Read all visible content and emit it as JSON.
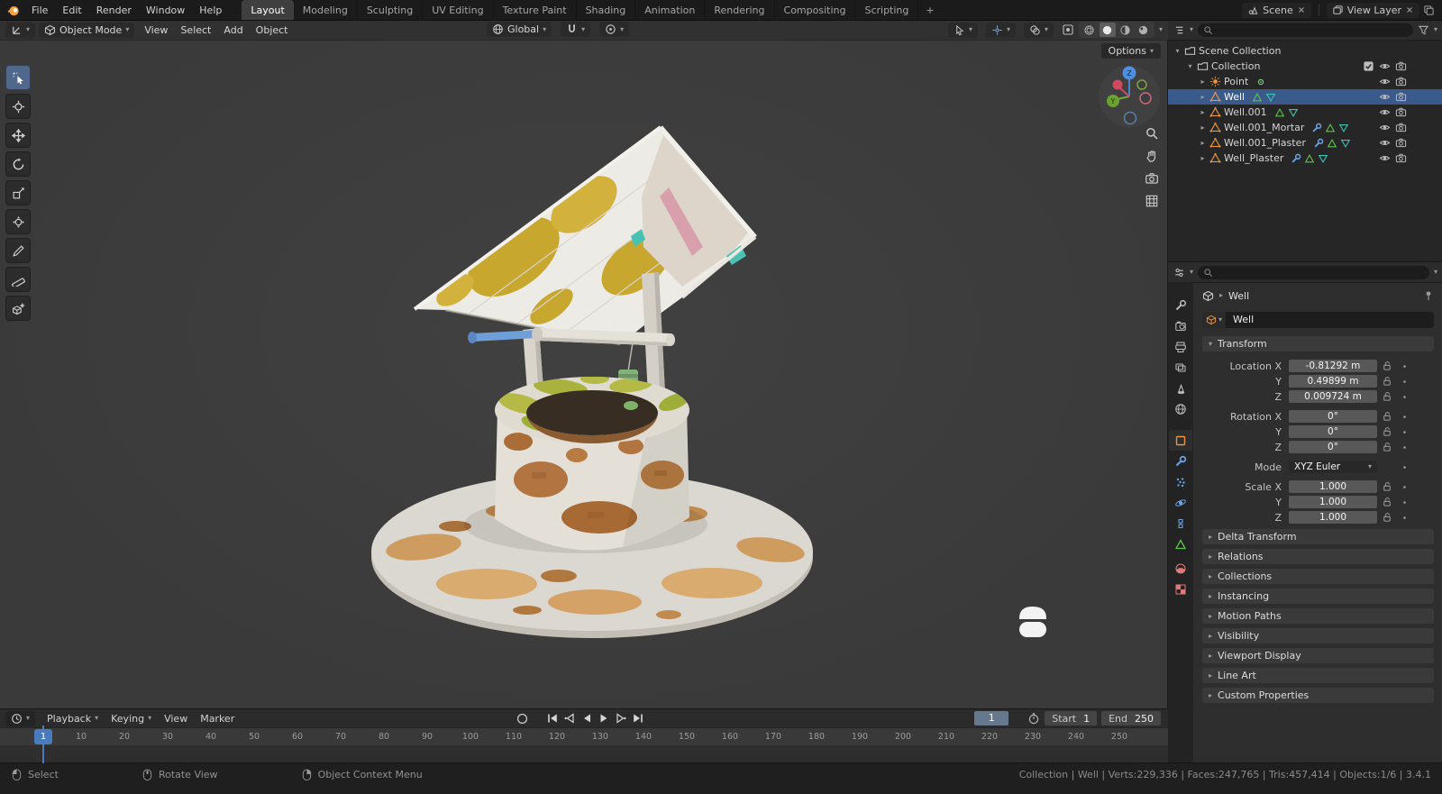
{
  "topbar": {
    "menus": [
      "File",
      "Edit",
      "Render",
      "Window",
      "Help"
    ],
    "workspaces": [
      "Layout",
      "Modeling",
      "Sculpting",
      "UV Editing",
      "Texture Paint",
      "Shading",
      "Animation",
      "Rendering",
      "Compositing",
      "Scripting"
    ],
    "active_workspace": "Layout",
    "add_workspace": "+",
    "scene_selector": "Scene",
    "view_layer_selector": "View Layer"
  },
  "viewport": {
    "header": {
      "mode": "Object Mode",
      "menus": [
        "View",
        "Select",
        "Add",
        "Object"
      ],
      "orientation": "Global",
      "options": "Options"
    },
    "toolbar": [
      "select-box",
      "cursor-3d",
      "move",
      "rotate",
      "scale",
      "transform",
      "annotate",
      "measure",
      "add-cube"
    ],
    "active_tool": "select-box",
    "gizmo": {
      "z": "Z",
      "y": "Y"
    }
  },
  "outliner": {
    "rows": [
      {
        "label": "Scene Collection",
        "depth": 0,
        "icon": "collection",
        "expand": "down",
        "badges": [],
        "right": []
      },
      {
        "label": "Collection",
        "depth": 1,
        "icon": "collection",
        "expand": "down",
        "badges": [],
        "right": [
          "checkbox",
          "eye",
          "camera"
        ]
      },
      {
        "label": "Point",
        "depth": 2,
        "icon": "light",
        "expand": "right",
        "badges": [
          "light-data"
        ],
        "right": [
          "eye",
          "camera"
        ]
      },
      {
        "label": "Well",
        "depth": 2,
        "icon": "mesh",
        "expand": "right",
        "selected": true,
        "badges": [
          "tri-green",
          "tri-teal"
        ],
        "right": [
          "eye",
          "camera"
        ]
      },
      {
        "label": "Well.001",
        "depth": 2,
        "icon": "mesh",
        "expand": "right",
        "badges": [
          "tri-green",
          "tri-teal"
        ],
        "right": [
          "eye",
          "camera"
        ]
      },
      {
        "label": "Well.001_Mortar",
        "depth": 2,
        "icon": "mesh",
        "expand": "right",
        "badges": [
          "wrench",
          "tri-green",
          "tri-teal"
        ],
        "right": [
          "eye",
          "camera"
        ]
      },
      {
        "label": "Well.001_Plaster",
        "depth": 2,
        "icon": "mesh",
        "expand": "right",
        "badges": [
          "wrench",
          "tri-green",
          "tri-teal"
        ],
        "right": [
          "eye",
          "camera"
        ]
      },
      {
        "label": "Well_Plaster",
        "depth": 2,
        "icon": "mesh",
        "expand": "right",
        "badges": [
          "wrench",
          "tri-green",
          "tri-teal"
        ],
        "right": [
          "eye",
          "camera"
        ]
      }
    ]
  },
  "properties": {
    "tabs": [
      {
        "name": "tool",
        "color": "#b8b8b8"
      },
      {
        "name": "render",
        "color": "#b8b8b8"
      },
      {
        "name": "output",
        "color": "#b8b8b8"
      },
      {
        "name": "view-layer",
        "color": "#b8b8b8"
      },
      {
        "name": "scene",
        "color": "#b8b8b8"
      },
      {
        "name": "world",
        "color": "#b8b8b8"
      },
      {
        "name": "object",
        "color": "#e8953f",
        "active": true
      },
      {
        "name": "modifiers",
        "color": "#6aa1e0"
      },
      {
        "name": "particles",
        "color": "#6aa1e0"
      },
      {
        "name": "physics",
        "color": "#6aa1e0"
      },
      {
        "name": "constraints",
        "color": "#6aa1e0"
      },
      {
        "name": "object-data",
        "color": "#5fc14e"
      },
      {
        "name": "material",
        "color": "#e07a7a"
      },
      {
        "name": "texture",
        "color": "#e07a7a"
      }
    ],
    "breadcrumb": "Well",
    "name_field": "Well",
    "transform": {
      "title": "Transform",
      "rows": [
        {
          "label": "Location X",
          "value": "-0.81292 m"
        },
        {
          "label": "Y",
          "value": "0.49899 m"
        },
        {
          "label": "Z",
          "value": "0.009724 m"
        },
        {
          "label": "Rotation X",
          "value": "0°",
          "gap": true
        },
        {
          "label": "Y",
          "value": "0°"
        },
        {
          "label": "Z",
          "value": "0°"
        },
        {
          "label": "Mode",
          "value": "XYZ Euler",
          "dropdown": true,
          "gap": true
        },
        {
          "label": "Scale X",
          "value": "1.000",
          "gap": true
        },
        {
          "label": "Y",
          "value": "1.000"
        },
        {
          "label": "Z",
          "value": "1.000"
        }
      ]
    },
    "sections": [
      "Delta Transform",
      "Relations",
      "Collections",
      "Instancing",
      "Motion Paths",
      "Visibility",
      "Viewport Display",
      "Line Art",
      "Custom Properties"
    ]
  },
  "timeline": {
    "menus": [
      {
        "label": "Playback",
        "chev": true
      },
      {
        "label": "Keying",
        "chev": true
      },
      {
        "label": "View"
      },
      {
        "label": "Marker"
      }
    ],
    "playhead": "1",
    "ticks": [
      "10",
      "20",
      "30",
      "40",
      "50",
      "60",
      "70",
      "80",
      "90",
      "100",
      "110",
      "120",
      "130",
      "140",
      "150",
      "160",
      "170",
      "180",
      "190",
      "200",
      "210",
      "220",
      "230",
      "240",
      "250"
    ],
    "current_frame": "1",
    "start_label": "Start",
    "start_value": "1",
    "end_label": "End",
    "end_value": "250"
  },
  "statusbar": {
    "hints": [
      {
        "icon": "mouse-left",
        "label": "Select"
      },
      {
        "icon": "mouse-middle",
        "label": "Rotate View"
      },
      {
        "icon": "mouse-right",
        "label": "Object Context Menu"
      }
    ],
    "info": "Collection | Well | Verts:229,336 | Faces:247,765 | Tris:457,414 | Objects:1/6 | 3.4.1"
  },
  "colors": {
    "accent": "#4772b3",
    "selection_row": "#3a5a8c",
    "object_orange": "#e8953f",
    "playhead_blue": "#4a7bbd"
  }
}
